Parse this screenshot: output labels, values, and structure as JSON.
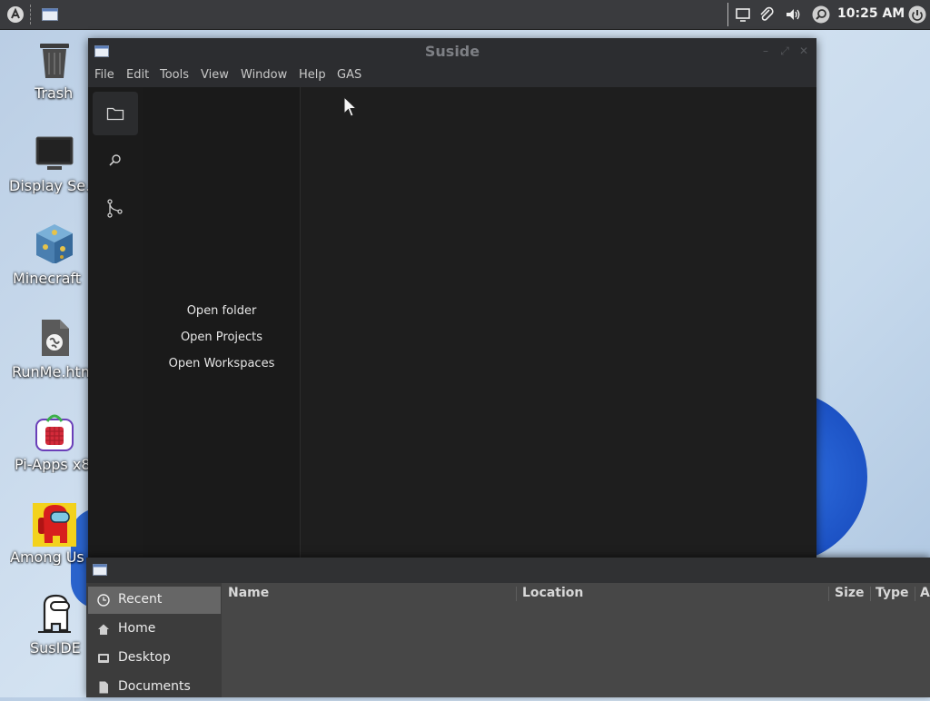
{
  "panel": {
    "clock": "10:25 AM"
  },
  "desktop": {
    "icons": [
      {
        "label": "Trash"
      },
      {
        "label": "Display Se..."
      },
      {
        "label": "Minecraft"
      },
      {
        "label": "RunMe.htm"
      },
      {
        "label": "Pi-Apps x8"
      },
      {
        "label": "Among Us"
      },
      {
        "label": "SusIDE"
      }
    ]
  },
  "ide": {
    "title": "Suside",
    "menu": [
      "File",
      "Edit",
      "Tools",
      "View",
      "Window",
      "Help",
      "GAS"
    ],
    "activity_icons": [
      "folder-icon",
      "search-icon",
      "source-control-icon"
    ],
    "sidebar_links": [
      "Open folder",
      "Open Projects",
      "Open Workspaces"
    ]
  },
  "file_dialog": {
    "places": [
      {
        "label": "Recent",
        "icon": "clock-icon",
        "selected": true
      },
      {
        "label": "Home",
        "icon": "home-icon"
      },
      {
        "label": "Desktop",
        "icon": "desktop-icon"
      },
      {
        "label": "Documents",
        "icon": "document-icon"
      }
    ],
    "columns": [
      "Name",
      "Location",
      "Size",
      "Type",
      "A"
    ]
  },
  "colors": {
    "panel_bg": "#3a3b3e",
    "ide_bg": "#1e1e1e",
    "dialog_bg": "#474747",
    "selected_place": "#666666"
  }
}
